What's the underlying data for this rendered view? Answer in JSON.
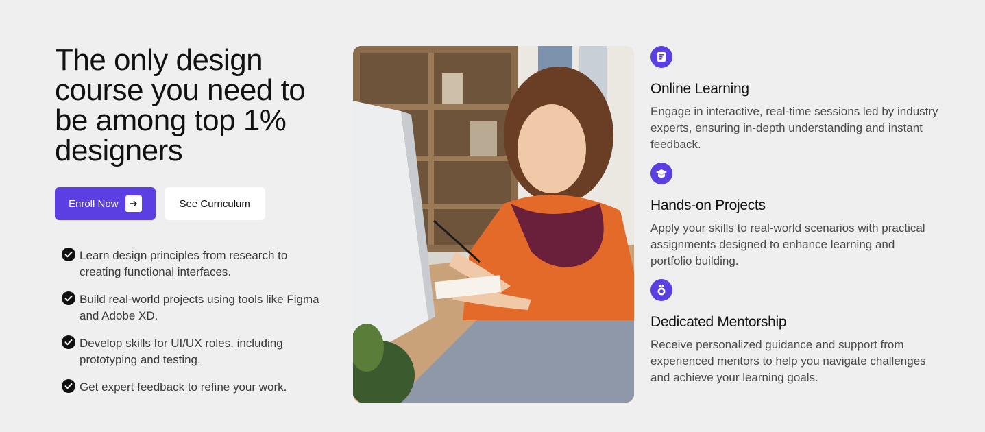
{
  "hero": {
    "title": "The only design course you need to be among top 1% designers"
  },
  "cta": {
    "primary_label": "Enroll Now",
    "secondary_label": "See Curriculum"
  },
  "checklist": [
    "Learn design principles from research to creating functional interfaces.",
    "Build real-world projects using tools like Figma and Adobe XD.",
    "Develop skills for UI/UX roles, including prototyping and testing.",
    "Get expert feedback to refine your work."
  ],
  "features": [
    {
      "icon": "document-icon",
      "title": "Online Learning",
      "description": "Engage in interactive, real-time sessions led by industry experts, ensuring in-depth understanding and instant feedback."
    },
    {
      "icon": "graduation-cap-icon",
      "title": "Hands-on Projects",
      "description": "Apply your skills to real-world scenarios with practical assignments designed to enhance learning and portfolio building."
    },
    {
      "icon": "medal-icon",
      "title": "Dedicated Mentorship",
      "description": "Receive personalized guidance and support from experienced mentors to help you navigate challenges and achieve your learning goals."
    }
  ],
  "colors": {
    "accent": "#5b3fe3",
    "background": "#efefef",
    "text": "#111111"
  }
}
